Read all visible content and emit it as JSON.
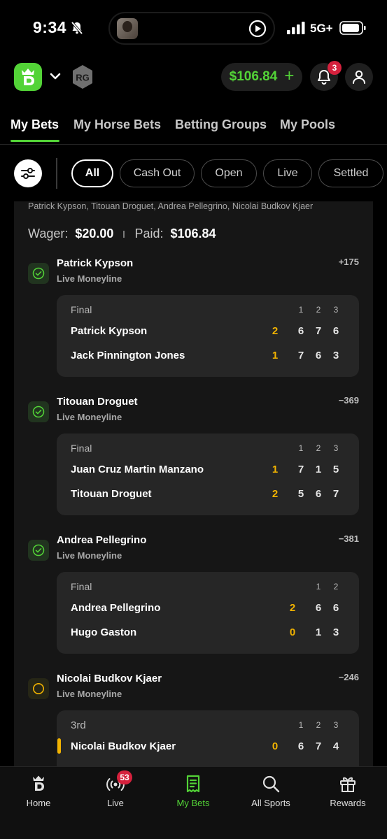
{
  "status_bar": {
    "time": "9:34",
    "network": "5G+"
  },
  "header": {
    "brand_icon": "draftkings-crown-logo",
    "rg_badge": "RG",
    "balance": "$106.84",
    "notification_count": "3"
  },
  "tabs": [
    {
      "label": "My Bets",
      "active": true
    },
    {
      "label": "My Horse Bets",
      "active": false
    },
    {
      "label": "Betting Groups",
      "active": false
    },
    {
      "label": "My Pools",
      "active": false
    }
  ],
  "filters": [
    "All",
    "Cash Out",
    "Open",
    "Live",
    "Settled"
  ],
  "active_filter": "All",
  "bet": {
    "legs_summary": "Patrick Kypson, Titouan Droguet, Andrea Pellegrino, Nicolai Budkov Kjaer",
    "wager_label": "Wager:",
    "wager": "$20.00",
    "paid_label": "Paid:",
    "paid": "$106.84",
    "legs": [
      {
        "selection": "Patrick Kypson",
        "market": "Live Moneyline",
        "odds": "+175",
        "status": "won",
        "score": {
          "status": "Final",
          "set_headers": [
            "1",
            "2",
            "3"
          ],
          "players": [
            {
              "name": "Patrick Kypson",
              "sets": "2",
              "games": [
                "6",
                "7",
                "6"
              ]
            },
            {
              "name": "Jack Pinnington Jones",
              "sets": "1",
              "games": [
                "7",
                "6",
                "3"
              ]
            }
          ]
        }
      },
      {
        "selection": "Titouan Droguet",
        "market": "Live Moneyline",
        "odds": "−369",
        "status": "won",
        "score": {
          "status": "Final",
          "set_headers": [
            "1",
            "2",
            "3"
          ],
          "players": [
            {
              "name": "Juan Cruz Martin Manzano",
              "sets": "1",
              "games": [
                "7",
                "1",
                "5"
              ]
            },
            {
              "name": "Titouan Droguet",
              "sets": "2",
              "games": [
                "5",
                "6",
                "7"
              ]
            }
          ]
        }
      },
      {
        "selection": "Andrea Pellegrino",
        "market": "Live Moneyline",
        "odds": "−381",
        "status": "won",
        "score": {
          "status": "Final",
          "set_headers": [
            "1",
            "2"
          ],
          "players": [
            {
              "name": "Andrea Pellegrino",
              "sets": "2",
              "games": [
                "6",
                "6"
              ]
            },
            {
              "name": "Hugo Gaston",
              "sets": "0",
              "games": [
                "1",
                "3"
              ]
            }
          ]
        }
      },
      {
        "selection": "Nicolai Budkov Kjaer",
        "market": "Live Moneyline",
        "odds": "−246",
        "status": "open",
        "score": {
          "status": "3rd",
          "set_headers": [
            "1",
            "2",
            "3"
          ],
          "players": [
            {
              "name": "Nicolai Budkov Kjaer",
              "sets": "0",
              "games": [
                "6",
                "7",
                "4"
              ],
              "serving": true
            }
          ]
        }
      }
    ]
  },
  "bottom_nav": [
    {
      "label": "Home",
      "icon": "home-crown-icon",
      "active": false
    },
    {
      "label": "Live",
      "icon": "live-broadcast-icon",
      "badge": "53",
      "active": false
    },
    {
      "label": "My Bets",
      "icon": "bet-slip-icon",
      "active": true
    },
    {
      "label": "All Sports",
      "icon": "search-icon",
      "active": false
    },
    {
      "label": "Rewards",
      "icon": "gift-icon",
      "active": false
    }
  ],
  "colors": {
    "accent_green": "#53d337",
    "sets_yellow": "#f2b300",
    "badge_red": "#d5213d"
  }
}
